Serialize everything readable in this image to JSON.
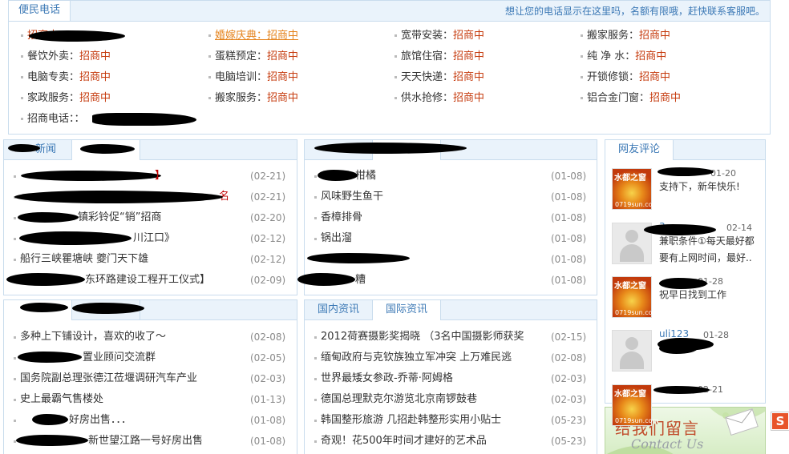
{
  "hotline": {
    "title": "便民电话",
    "notice": "想让您的电话显示在这里吗，名额有限哦，赶快联系客服吧。",
    "rows": [
      [
        {
          "label": "",
          "value": "招商中"
        },
        {
          "label": "婚嫁庆典：",
          "value": "招商中"
        },
        {
          "label": "宽带安装：",
          "value": "招商中"
        },
        {
          "label": "搬家服务：",
          "value": "招商中"
        }
      ],
      [
        {
          "label": "餐饮外卖：",
          "value": "招商中"
        },
        {
          "label": "蛋糕预定：",
          "value": "招商中"
        },
        {
          "label": "旅馆住宿：",
          "value": "招商中"
        },
        {
          "label": "纯 净 水：",
          "value": "招商中"
        }
      ],
      [
        {
          "label": "电脑专卖：",
          "value": "招商中"
        },
        {
          "label": "电脑培训：",
          "value": "招商中"
        },
        {
          "label": "天天快递：",
          "value": "招商中"
        },
        {
          "label": "开锁修锁：",
          "value": "招商中"
        }
      ],
      [
        {
          "label": "家政服务：",
          "value": "招商中"
        },
        {
          "label": "搬家服务：",
          "value": "招商中"
        },
        {
          "label": "供水抢修：",
          "value": "招商中"
        },
        {
          "label": "铝合金门窗：",
          "value": "招商中"
        }
      ]
    ],
    "last_label": "招商电话：："
  },
  "panel1": {
    "tab1": "新闻",
    "items": [
      {
        "text": "",
        "date": "(02-21)"
      },
      {
        "text": "名",
        "date": "(02-21)"
      },
      {
        "text": "镇彩铃促“销”招商",
        "date": "(02-20)"
      },
      {
        "text": "川江口》",
        "date": "(02-12)"
      },
      {
        "text": "船行三峡瞿塘峡  夔门天下雄",
        "date": "(02-12)"
      },
      {
        "text": "东环路建设工程开工仪式】",
        "date": "(02-09)"
      }
    ]
  },
  "panel2": {
    "items": [
      {
        "text": "柑橘",
        "date": "(01-08)"
      },
      {
        "text": "风味野生鱼干",
        "date": "(01-08)"
      },
      {
        "text": "香樟排骨",
        "date": "(01-08)"
      },
      {
        "text": "锅出溜",
        "date": "(01-08)"
      },
      {
        "text": "",
        "date": "(01-08)"
      },
      {
        "text": "糟",
        "date": "(01-08)"
      }
    ]
  },
  "panel3": {
    "items": [
      {
        "text": "多种上下铺设计，喜欢的收了～",
        "date": "(02-08)"
      },
      {
        "text": "置业顾问交流群",
        "date": "(02-05)"
      },
      {
        "text": "国务院副总理张德江莅堰调研汽车产业",
        "date": "(02-03)"
      },
      {
        "text": "史上最霸气售楼处",
        "date": "(01-13)"
      },
      {
        "text": "好房出售．．．",
        "date": "(01-08)"
      },
      {
        "text": "新世望江路一号好房出售",
        "date": "(01-08)"
      }
    ]
  },
  "panel4": {
    "tab1": "国内资讯",
    "tab2": "国际资讯",
    "items": [
      {
        "text": "2012荷赛摄影奖揭晓  （3名中国摄影师获奖",
        "date": "(02-15)"
      },
      {
        "text": "缅甸政府与克钦族独立军冲突  上万难民逃",
        "date": "(02-08)"
      },
      {
        "text": "世界最矮女参政-乔蒂·阿姆格",
        "date": "(02-03)"
      },
      {
        "text": "德国总理默克尔游览北京南锣鼓巷",
        "date": "(02-03)"
      },
      {
        "text": "韩国整形旅游  几招赴韩整形实用小贴士",
        "date": "(05-23)"
      },
      {
        "text": "奇观！花500年时间才建好的艺术品",
        "date": "(05-23)"
      }
    ]
  },
  "comments": {
    "title": "网友评论",
    "items": [
      {
        "user": "",
        "date": "01-20",
        "lines": [
          "支持下，新年快乐!"
        ],
        "avatar": "logo"
      },
      {
        "user": "3",
        "date": "02-14",
        "lines": [
          "兼职条件①每天最好都",
          "要有上网时间，最好.."
        ],
        "avatar": "default"
      },
      {
        "user": "",
        "date": "01-28",
        "lines": [
          "祝早日找到工作"
        ],
        "avatar": "logo"
      },
      {
        "user": "uli123",
        "date": "01-28",
        "lines": [
          ""
        ],
        "avatar": "default"
      },
      {
        "user": "",
        "date": "02-21",
        "lines": [
          ""
        ],
        "avatar": "logo"
      }
    ],
    "logo_text": "水都之窗",
    "logo_url": "0719sun.com"
  },
  "banner": {
    "cn": "给我们留言",
    "en": "Contact Us"
  },
  "colors": {
    "accent": "#3b78b5",
    "orange": "#c63c0f",
    "border": "#c9dced",
    "tabbg": "#eaf3fb"
  }
}
